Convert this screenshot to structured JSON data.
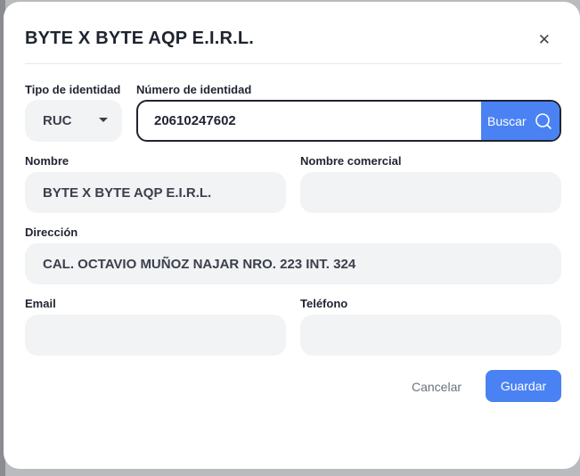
{
  "modal": {
    "title": "BYTE X BYTE AQP E.I.R.L.",
    "close_icon": "close-icon"
  },
  "form": {
    "tipo_identidad": {
      "label": "Tipo de identidad",
      "value": "RUC"
    },
    "numero_identidad": {
      "label": "Número de identidad",
      "value": "20610247602"
    },
    "search": {
      "label": "Buscar",
      "icon": "search-icon"
    },
    "nombre": {
      "label": "Nombre",
      "value": "BYTE X BYTE AQP E.I.R.L."
    },
    "nombre_comercial": {
      "label": "Nombre comercial",
      "value": ""
    },
    "direccion": {
      "label": "Dirección",
      "value": "CAL. OCTAVIO MUÑOZ NAJAR NRO. 223 INT. 324"
    },
    "email": {
      "label": "Email",
      "value": ""
    },
    "telefono": {
      "label": "Teléfono",
      "value": ""
    }
  },
  "actions": {
    "cancel_label": "Cancelar",
    "save_label": "Guardar"
  },
  "colors": {
    "accent": "#4a82f4",
    "field_bg": "#f2f3f5",
    "text": "#1f2430"
  }
}
